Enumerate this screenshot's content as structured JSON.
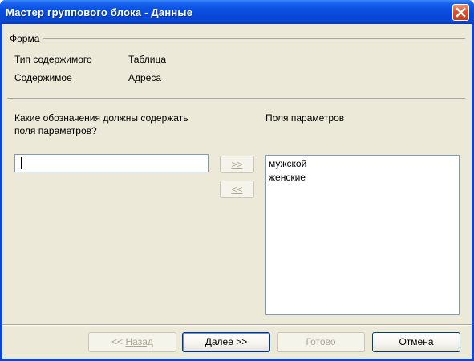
{
  "window": {
    "title": "Мастер группового блока - Данные"
  },
  "form_section": {
    "heading": "Форма",
    "rows": [
      {
        "label": "Тип содержимого",
        "value": "Таблица"
      },
      {
        "label": "Содержимое",
        "value": "Адреса"
      }
    ]
  },
  "question": {
    "line1": "Какие обозначения должны содержать",
    "line2": "поля параметров?"
  },
  "input": {
    "value": ""
  },
  "move_buttons": {
    "add_label": ">>",
    "remove_label": "<<"
  },
  "options_list": {
    "heading": "Поля параметров",
    "items": [
      "мужской",
      "женские"
    ]
  },
  "footer": {
    "back_prefix": "<< ",
    "back_label": "Назад",
    "next_label": "Далее >>",
    "finish_label": "Готово",
    "cancel_label": "Отмена"
  },
  "colors": {
    "titlebar": "#0a50e0",
    "dialog_bg": "#ece9d8",
    "close_button": "#d8532e",
    "disabled_text": "#aca899"
  },
  "icons": {
    "close": "close-x-icon"
  }
}
